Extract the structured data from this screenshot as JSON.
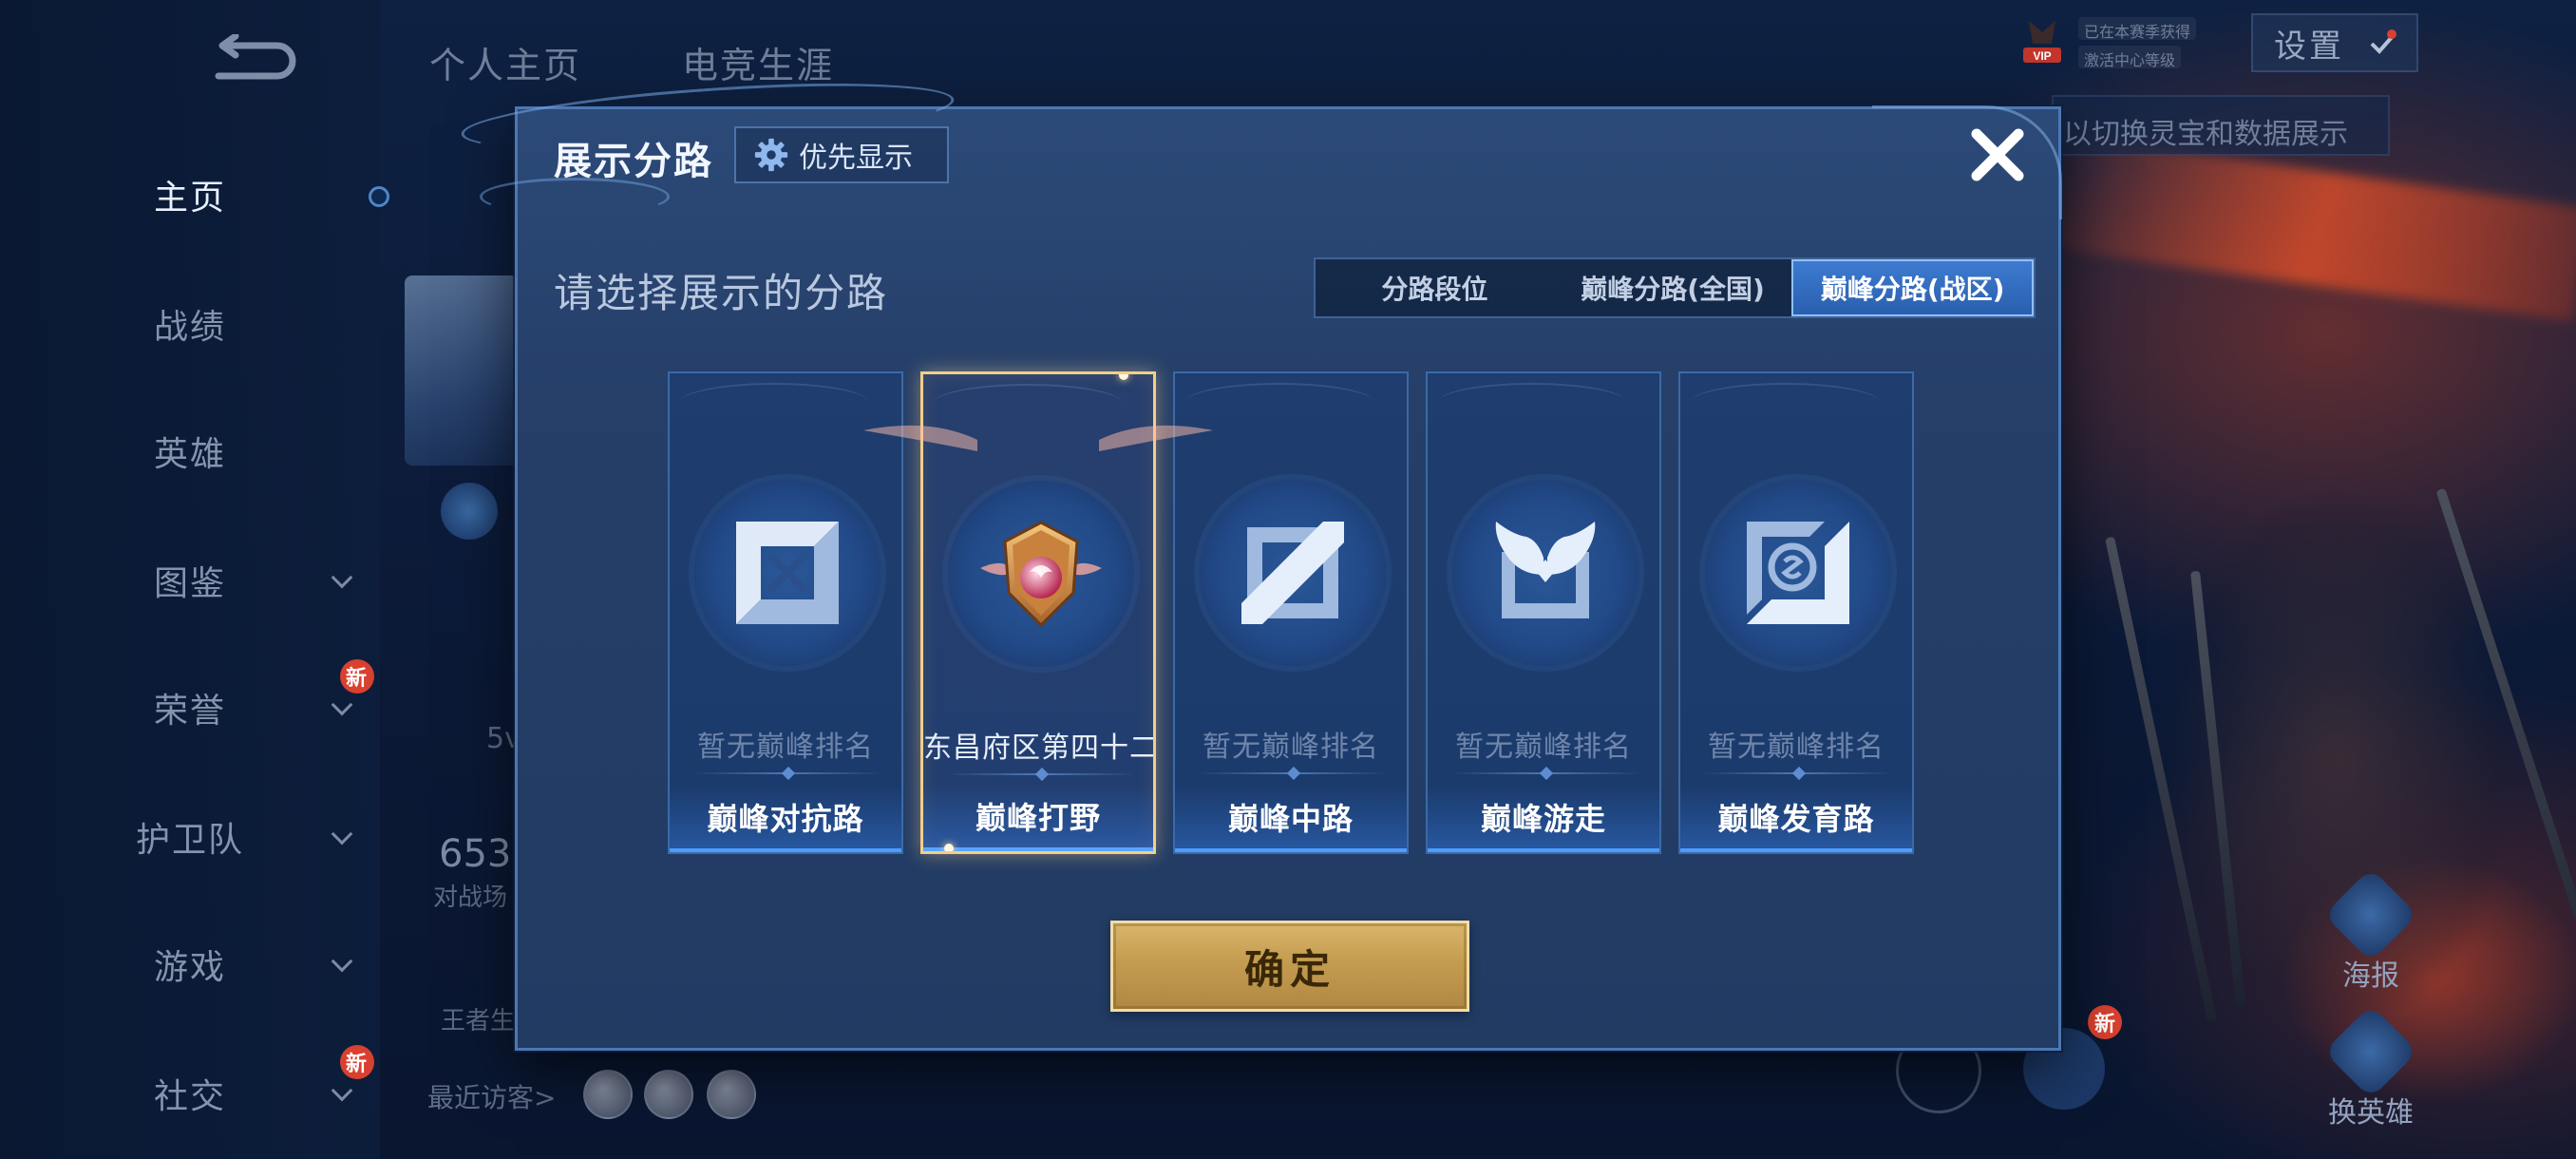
{
  "nav": {
    "items": [
      {
        "label": "主页",
        "active": true,
        "chevron": false,
        "badge": ""
      },
      {
        "label": "战绩",
        "active": false,
        "chevron": false,
        "badge": ""
      },
      {
        "label": "英雄",
        "active": false,
        "chevron": false,
        "badge": ""
      },
      {
        "label": "图鉴",
        "active": false,
        "chevron": true,
        "badge": ""
      },
      {
        "label": "荣誉",
        "active": false,
        "chevron": true,
        "badge": "新"
      },
      {
        "label": "护卫队",
        "active": false,
        "chevron": true,
        "badge": ""
      },
      {
        "label": "游戏",
        "active": false,
        "chevron": true,
        "badge": ""
      },
      {
        "label": "社交",
        "active": false,
        "chevron": true,
        "badge": "新"
      }
    ]
  },
  "top": {
    "tabs": [
      "个人主页",
      "电竞生涯"
    ],
    "vip_label": "VIP",
    "vip_line1": "已在本赛季获得",
    "vip_line2": "激活中心等级",
    "settings_label": "设置",
    "hint_text": "以切换灵宝和数据展示"
  },
  "background": {
    "stat_number": "653",
    "stat_caption": "对战场",
    "king_caption": "王者生",
    "small_number": "5v",
    "visitors_label": "最近访客>"
  },
  "side_buttons": [
    {
      "label": "海报"
    },
    {
      "label": "换英雄"
    }
  ],
  "side_badge": "新",
  "modal": {
    "title": "展示分路",
    "priority_label": "优先显示",
    "subtitle": "请选择展示的分路",
    "tabs": [
      {
        "label": "分路段位",
        "active": false
      },
      {
        "label": "巅峰分路(全国)",
        "active": false
      },
      {
        "label": "巅峰分路(战区)",
        "active": true
      }
    ],
    "lanes": [
      {
        "name": "巅峰对抗路",
        "rank": "暂无巅峰排名",
        "icon": "clash-lane-icon",
        "selected": false
      },
      {
        "name": "巅峰打野",
        "rank": "东昌府区第四十二",
        "icon": "jungle-emblem-icon",
        "selected": true
      },
      {
        "name": "巅峰中路",
        "rank": "暂无巅峰排名",
        "icon": "mid-lane-icon",
        "selected": false
      },
      {
        "name": "巅峰游走",
        "rank": "暂无巅峰排名",
        "icon": "roam-wings-icon",
        "selected": false
      },
      {
        "name": "巅峰发育路",
        "rank": "暂无巅峰排名",
        "icon": "farm-lane-icon",
        "selected": false
      }
    ],
    "confirm_label": "确定"
  },
  "colors": {
    "accent_blue": "#3d7bd0",
    "gold": "#d9b56b",
    "selected_border": "#f1cf8a"
  }
}
